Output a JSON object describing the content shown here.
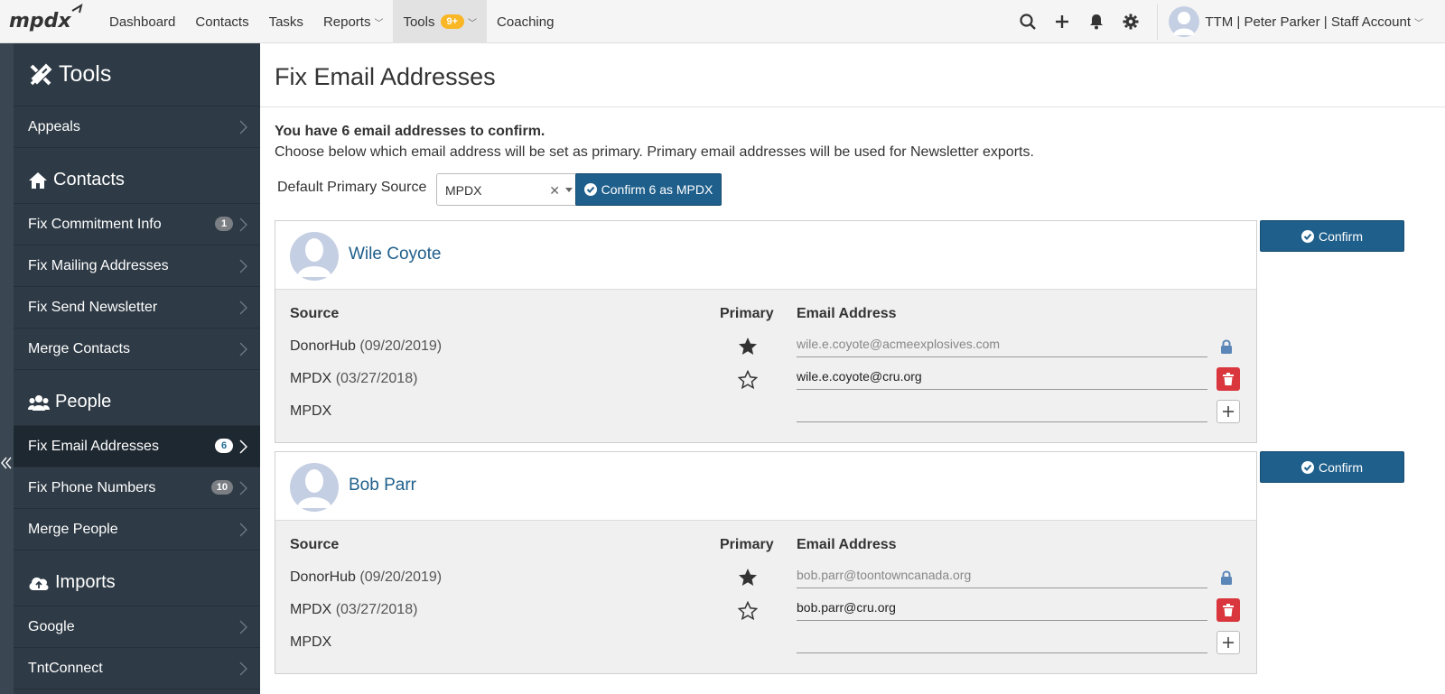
{
  "nav": {
    "items": [
      {
        "label": "Dashboard"
      },
      {
        "label": "Contacts"
      },
      {
        "label": "Tasks"
      },
      {
        "label": "Reports"
      },
      {
        "label": "Tools",
        "badge": "9+"
      },
      {
        "label": "Coaching"
      }
    ],
    "account": "TTM | Peter Parker | Staff Account",
    "icons": [
      "search-icon",
      "plus-icon",
      "bell-icon",
      "gear-icon"
    ]
  },
  "sidebar": {
    "title": "Tools",
    "sections": [
      {
        "items": [
          {
            "label": "Appeals"
          }
        ]
      },
      {
        "heading": "Contacts",
        "items": [
          {
            "label": "Fix Commitment Info",
            "badge": "1"
          },
          {
            "label": "Fix Mailing Addresses"
          },
          {
            "label": "Fix Send Newsletter"
          },
          {
            "label": "Merge Contacts"
          }
        ]
      },
      {
        "heading": "People",
        "items": [
          {
            "label": "Fix Email Addresses",
            "badge": "6",
            "active": true
          },
          {
            "label": "Fix Phone Numbers",
            "badge": "10"
          },
          {
            "label": "Merge People"
          }
        ]
      },
      {
        "heading": "Imports",
        "items": [
          {
            "label": "Google"
          },
          {
            "label": "TntConnect"
          }
        ]
      }
    ]
  },
  "main": {
    "title": "Fix Email Addresses",
    "intro_bold": "You have 6 email addresses to confirm.",
    "intro_text": "Choose below which email address will be set as primary. Primary email addresses will be used for Newsletter exports.",
    "default_source_label": "Default Primary Source",
    "default_source_value": "MPDX",
    "confirm_all_label": "Confirm 6 as MPDX",
    "confirm_label": "Confirm",
    "col_source": "Source",
    "col_primary": "Primary",
    "col_email": "Email Address",
    "people": [
      {
        "name": "Wile Coyote",
        "rows": [
          {
            "source": "DonorHub",
            "date": "(09/20/2019)",
            "primary": true,
            "email": "wile.e.coyote@acmeexplosives.com",
            "locked": true
          },
          {
            "source": "MPDX",
            "date": "(03/27/2018)",
            "primary": false,
            "email": "wile.e.coyote@cru.org",
            "locked": false
          },
          {
            "source": "MPDX",
            "date": "",
            "primary": null,
            "email": "",
            "new": true
          }
        ]
      },
      {
        "name": "Bob Parr",
        "rows": [
          {
            "source": "DonorHub",
            "date": "(09/20/2019)",
            "primary": true,
            "email": "bob.parr@toontowncanada.org",
            "locked": true
          },
          {
            "source": "MPDX",
            "date": "(03/27/2018)",
            "primary": false,
            "email": "bob.parr@cru.org",
            "locked": false
          },
          {
            "source": "MPDX",
            "date": "",
            "primary": null,
            "email": "",
            "new": true
          }
        ]
      }
    ]
  },
  "colors": {
    "sidebar_bg": "#2e3a45",
    "primary_blue": "#1f5f8b",
    "badge_yellow": "#f9b625",
    "danger_red": "#d9363e"
  }
}
